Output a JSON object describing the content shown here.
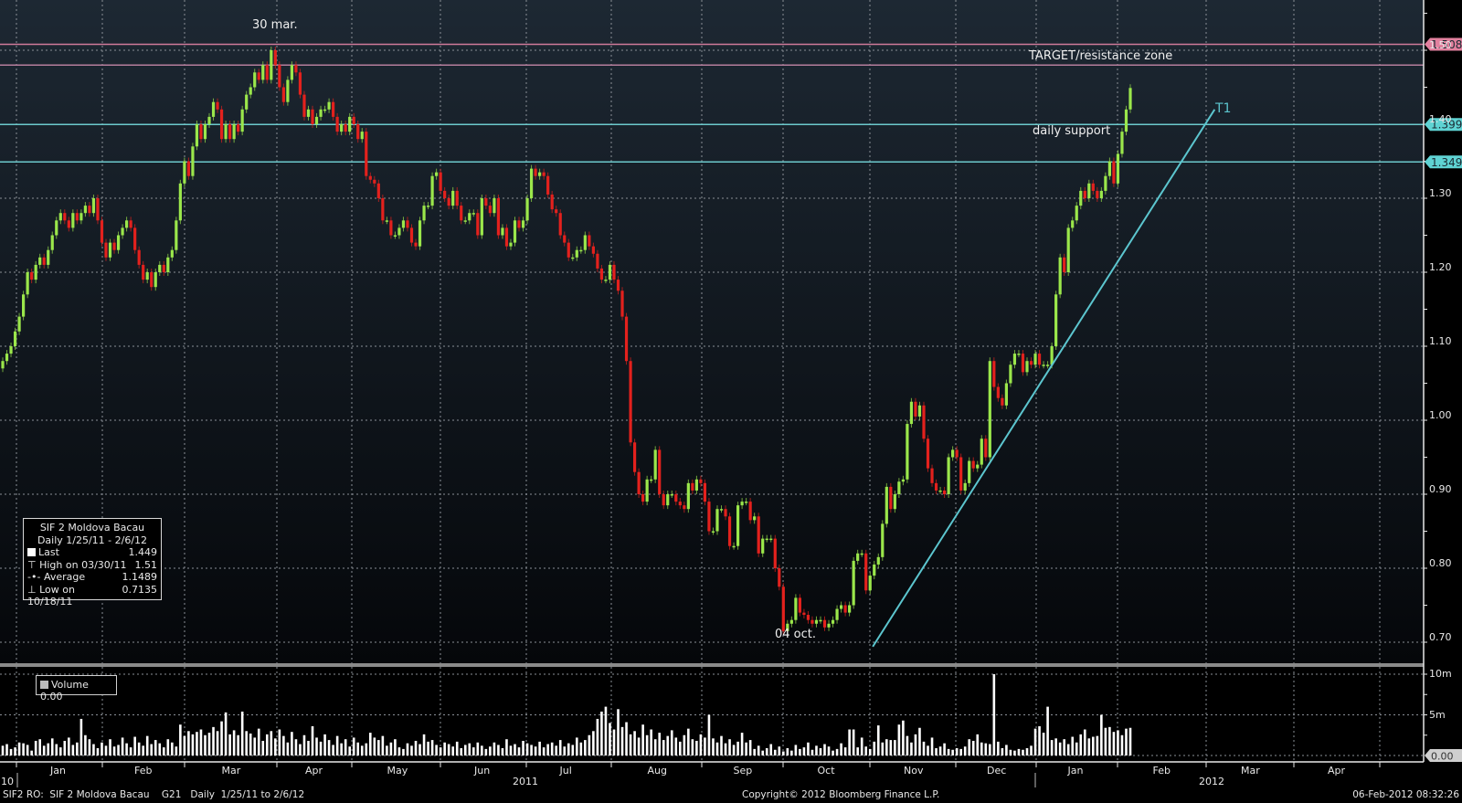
{
  "chart_data": {
    "type": "candlestick",
    "title": "SIF 2 Moldova Bacau",
    "period": "Daily 1/25/11 - 2/6/12",
    "colors": {
      "up": "#9be74b",
      "down": "#e3211d",
      "volume": "#ffffff",
      "support": "#6cc9cc",
      "resistance": "#d07a9a"
    },
    "y_ticks": [
      "1.50",
      "1.40",
      "1.30",
      "1.20",
      "1.10",
      "1.00",
      "0.90",
      "0.80",
      "0.70"
    ],
    "ylim": [
      0.7,
      1.5
    ],
    "volume_ticks": [
      "10m",
      "5m",
      "0.00"
    ],
    "volume_ylim": [
      0,
      10
    ],
    "x_months": [
      "Jan",
      "Feb",
      "Mar",
      "Apr",
      "May",
      "Jun",
      "Jul",
      "Aug",
      "Sep",
      "Oct",
      "Nov",
      "Dec",
      "Jan",
      "Feb",
      "Mar",
      "Apr"
    ],
    "x_years": [
      "10",
      "2011",
      "2012"
    ],
    "grid": true,
    "close": [
      1.08,
      1.09,
      1.1,
      1.12,
      1.14,
      1.17,
      1.2,
      1.19,
      1.21,
      1.22,
      1.21,
      1.23,
      1.25,
      1.27,
      1.28,
      1.27,
      1.26,
      1.28,
      1.27,
      1.28,
      1.29,
      1.28,
      1.3,
      1.27,
      1.24,
      1.22,
      1.24,
      1.23,
      1.25,
      1.26,
      1.27,
      1.26,
      1.23,
      1.21,
      1.19,
      1.2,
      1.18,
      1.2,
      1.21,
      1.2,
      1.22,
      1.23,
      1.27,
      1.32,
      1.35,
      1.33,
      1.37,
      1.4,
      1.38,
      1.4,
      1.41,
      1.43,
      1.42,
      1.38,
      1.4,
      1.38,
      1.4,
      1.39,
      1.42,
      1.44,
      1.45,
      1.47,
      1.46,
      1.48,
      1.46,
      1.5,
      1.48,
      1.45,
      1.43,
      1.46,
      1.48,
      1.47,
      1.44,
      1.41,
      1.42,
      1.4,
      1.41,
      1.42,
      1.42,
      1.43,
      1.41,
      1.39,
      1.4,
      1.39,
      1.41,
      1.4,
      1.38,
      1.39,
      1.33,
      1.325,
      1.32,
      1.3,
      1.27,
      1.27,
      1.25,
      1.25,
      1.26,
      1.27,
      1.26,
      1.24,
      1.235,
      1.27,
      1.29,
      1.29,
      1.33,
      1.335,
      1.31,
      1.3,
      1.29,
      1.31,
      1.29,
      1.27,
      1.27,
      1.28,
      1.28,
      1.25,
      1.3,
      1.29,
      1.28,
      1.3,
      1.25,
      1.26,
      1.235,
      1.24,
      1.27,
      1.26,
      1.27,
      1.3,
      1.34,
      1.33,
      1.335,
      1.33,
      1.305,
      1.285,
      1.28,
      1.25,
      1.24,
      1.22,
      1.22,
      1.23,
      1.23,
      1.25,
      1.235,
      1.225,
      1.205,
      1.19,
      1.19,
      1.21,
      1.19,
      1.175,
      1.14,
      1.08,
      0.97,
      0.93,
      0.9,
      0.89,
      0.92,
      0.92,
      0.96,
      0.9,
      0.885,
      0.9,
      0.9,
      0.89,
      0.885,
      0.88,
      0.915,
      0.905,
      0.92,
      0.915,
      0.89,
      0.85,
      0.85,
      0.88,
      0.88,
      0.87,
      0.83,
      0.83,
      0.885,
      0.89,
      0.89,
      0.865,
      0.87,
      0.82,
      0.84,
      0.84,
      0.84,
      0.8,
      0.775,
      0.715,
      0.725,
      0.73,
      0.76,
      0.74,
      0.737,
      0.73,
      0.725,
      0.73,
      0.73,
      0.72,
      0.725,
      0.73,
      0.745,
      0.75,
      0.74,
      0.75,
      0.81,
      0.82,
      0.82,
      0.77,
      0.79,
      0.805,
      0.815,
      0.86,
      0.91,
      0.88,
      0.9,
      0.917,
      0.92,
      0.995,
      1.025,
      1.005,
      1.02,
      0.975,
      0.935,
      0.915,
      0.905,
      0.905,
      0.9,
      0.95,
      0.96,
      0.95,
      0.905,
      0.915,
      0.945,
      0.935,
      0.94,
      0.975,
      0.95,
      1.08,
      1.045,
      1.03,
      1.02,
      1.05,
      1.075,
      1.09,
      1.09,
      1.065,
      1.08,
      1.075,
      1.09,
      1.075,
      1.075,
      1.075,
      1.1,
      1.17,
      1.22,
      1.2,
      1.26,
      1.27,
      1.29,
      1.31,
      1.3,
      1.32,
      1.31,
      1.3,
      1.31,
      1.33,
      1.35,
      1.32,
      1.36,
      1.39,
      1.42,
      1.449
    ],
    "volume_m": [
      1.2,
      1.4,
      0.8,
      1.0,
      1.6,
      1.5,
      1.3,
      0.6,
      1.8,
      2.0,
      1.2,
      1.5,
      2.1,
      1.4,
      1.0,
      1.8,
      2.2,
      1.3,
      1.6,
      4.5,
      2.5,
      2.0,
      1.4,
      0.9,
      1.6,
      1.2,
      2.0,
      1.1,
      1.3,
      2.2,
      1.5,
      1.0,
      2.3,
      1.6,
      1.2,
      2.4,
      1.4,
      1.9,
      1.5,
      1.0,
      2.0,
      1.6,
      1.1,
      3.8,
      2.4,
      3.0,
      2.6,
      2.9,
      3.2,
      2.5,
      2.8,
      3.5,
      3.0,
      4.2,
      5.3,
      2.6,
      3.1,
      2.5,
      5.4,
      3.0,
      2.7,
      2.2,
      3.3,
      1.8,
      2.6,
      3.0,
      2.1,
      3.2,
      2.4,
      1.6,
      2.9,
      2.0,
      1.4,
      2.5,
      1.8,
      3.6,
      2.2,
      1.7,
      2.6,
      1.9,
      1.3,
      2.4,
      1.5,
      2.0,
      1.1,
      2.2,
      1.6,
      1.2,
      1.5,
      2.8,
      2.2,
      1.9,
      2.4,
      1.2,
      1.6,
      2.0,
      1.0,
      0.8,
      1.5,
      1.2,
      1.8,
      1.4,
      2.6,
      1.7,
      1.9,
      1.3,
      1.0,
      1.6,
      1.4,
      1.1,
      1.7,
      0.9,
      1.3,
      1.5,
      1.0,
      1.6,
      1.2,
      0.8,
      1.1,
      1.6,
      1.3,
      0.9,
      2.0,
      1.2,
      1.4,
      1.0,
      1.8,
      1.5,
      1.3,
      1.1,
      1.7,
      1.0,
      1.4,
      1.6,
      1.2,
      1.9,
      1.1,
      1.5,
      1.3,
      2.2,
      1.6,
      1.9,
      2.5,
      3.0,
      4.5,
      5.4,
      6.0,
      4.0,
      3.2,
      5.7,
      3.5,
      4.1,
      2.6,
      3.0,
      2.2,
      3.8,
      2.5,
      3.2,
      2.0,
      2.8,
      1.9,
      2.4,
      3.1,
      2.2,
      1.7,
      2.5,
      3.3,
      2.0,
      1.8,
      2.6,
      2.2,
      5.0,
      2.1,
      1.6,
      2.4,
      1.5,
      2.0,
      1.3,
      1.7,
      2.8,
      1.6,
      1.9,
      0.8,
      1.2,
      0.6,
      0.9,
      1.4,
      0.7,
      1.1,
      0.5,
      0.9,
      0.6,
      1.3,
      0.8,
      1.0,
      1.6,
      0.7,
      1.2,
      0.9,
      1.4,
      1.1,
      0.6,
      0.8,
      1.5,
      1.0,
      3.2,
      3.2,
      1.0,
      2.2,
      1.1,
      0.8,
      1.7,
      3.7,
      1.6,
      2.0,
      1.9,
      1.9,
      3.8,
      4.3,
      2.4,
      1.6,
      2.6,
      3.4,
      1.7,
      1.2,
      2.2,
      0.9,
      1.1,
      1.5,
      0.8,
      0.7,
      0.9,
      0.8,
      1.1,
      2.0,
      1.8,
      2.6,
      1.6,
      1.5,
      1.4,
      10.0,
      1.7,
      0.9,
      1.3,
      0.7,
      0.6,
      0.8,
      0.7,
      0.9,
      1.2,
      3.3,
      3.6,
      2.8,
      6.0,
      1.9,
      2.1,
      1.6,
      2.0,
      1.4,
      2.3,
      1.6,
      2.6,
      3.2,
      2.1,
      2.3,
      2.4,
      5.0,
      3.4,
      3.5,
      2.9,
      3.1,
      2.5,
      3.3,
      3.4
    ],
    "reference_lines": [
      {
        "value": 1.508,
        "label": "1.508",
        "color": "#d07a9a",
        "tag_color": "#e2809e"
      },
      {
        "value": 1.48,
        "label": "",
        "color": "#b57e9c"
      },
      {
        "value": 1.3997,
        "label": "1.3997",
        "color": "#6cc9cc",
        "tag_color": "#5fd3d3"
      },
      {
        "value": 1.349,
        "label": "1.349",
        "color": "#6cc9cc",
        "tag_color": "#5fd3d3"
      }
    ],
    "trendline": {
      "label": "T1",
      "color": "#5cc6cf",
      "start": {
        "date": "2011-11-02",
        "value": 0.694
      },
      "end": {
        "date": "2012-03-04",
        "value": 1.42
      }
    },
    "annotations": {
      "high": "30 mar.",
      "low": "04 oct.",
      "target": "TARGET/resistance zone",
      "support": "daily support"
    },
    "legend": {
      "title": "SIF 2 Moldova Bacau",
      "subtitle": "Daily 1/25/11 - 2/6/12",
      "rows": [
        {
          "icon": "last-square-icon",
          "label": "Last",
          "value": "1.449"
        },
        {
          "icon": "high-marker-icon",
          "label": "High on 03/30/11",
          "value": "1.51"
        },
        {
          "icon": "average-marker-icon",
          "label": "Average",
          "value": "1.1489"
        },
        {
          "icon": "low-marker-icon",
          "label": "Low on 10/18/11",
          "value": "0.7135"
        }
      ]
    },
    "volume_legend": {
      "label": "Volume",
      "value": "0.00"
    }
  },
  "footer": {
    "ticker_info": "SIF2 RO:  SIF 2 Moldova Bacau    G21   Daily  1/25/11 to 2/6/12",
    "copyright": "Copyright© 2012 Bloomberg Finance L.P.",
    "timestamp": "06-Feb-2012 08:32:26"
  }
}
